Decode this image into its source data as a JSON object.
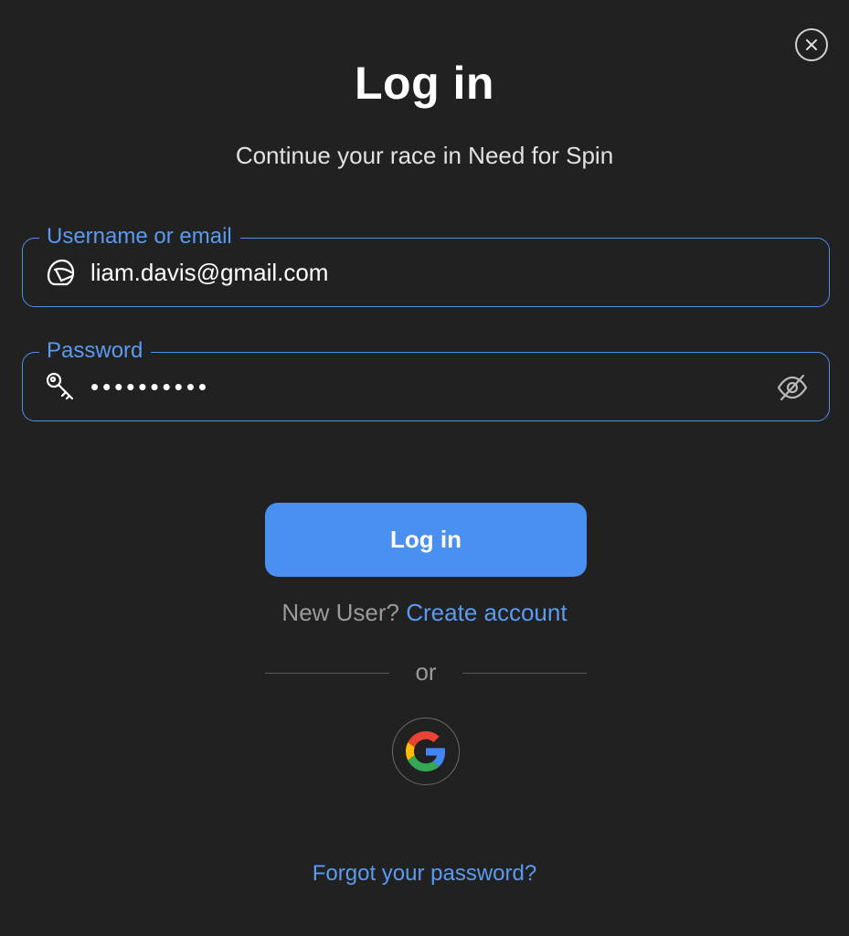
{
  "modal": {
    "title": "Log in",
    "subtitle": "Continue your race in Need for Spin"
  },
  "icons": {
    "close": "close-icon",
    "username": "helmet-icon",
    "password": "key-icon",
    "toggle": "eye-off-icon",
    "google": "google-icon"
  },
  "username_field": {
    "label": "Username or email",
    "value": "liam.davis@gmail.com"
  },
  "password_field": {
    "label": "Password",
    "value": "••••••••••"
  },
  "login_button": {
    "label": "Log in"
  },
  "signup": {
    "prompt": "New User?",
    "link": "Create account"
  },
  "divider": {
    "text": "or"
  },
  "forgot": {
    "link": "Forgot your password?"
  },
  "colors": {
    "background": "#212122",
    "accent": "#4a90f0",
    "link": "#5a9bf0",
    "muted": "#9a9a9a"
  }
}
